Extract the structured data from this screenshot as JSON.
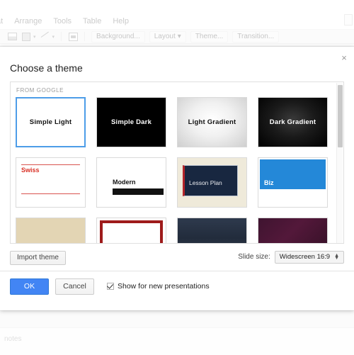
{
  "background_app": {
    "menubar": [
      {
        "label": "at"
      },
      {
        "label": "Arrange"
      },
      {
        "label": "Tools"
      },
      {
        "label": "Table"
      },
      {
        "label": "Help"
      }
    ],
    "toolbar": {
      "background_button": "Background...",
      "layout_button": "Layout",
      "theme_button": "Theme...",
      "transition_button": "Transition...",
      "caret": "▾"
    },
    "notes_label": "notes"
  },
  "dialog": {
    "title": "Choose a theme",
    "close_icon": "×",
    "group_label": "FROM GOOGLE",
    "themes": [
      {
        "name": "Simple Light",
        "style": "sw-simple-light",
        "selected": true
      },
      {
        "name": "Simple Dark",
        "style": "sw-simple-dark",
        "selected": false
      },
      {
        "name": "Light Gradient",
        "style": "sw-light-grad",
        "selected": false
      },
      {
        "name": "Dark Gradient",
        "style": "sw-dark-grad",
        "selected": false
      },
      {
        "name": "Swiss",
        "style": "sw-swiss",
        "selected": false
      },
      {
        "name": "Modern",
        "style": "sw-modern",
        "selected": false
      },
      {
        "name": "Lesson Plan",
        "style": "sw-lesson",
        "selected": false
      },
      {
        "name": "Biz",
        "style": "sw-biz",
        "selected": false
      },
      {
        "name": "",
        "style": "sw-plain-tan",
        "selected": false
      },
      {
        "name": "",
        "style": "sw-red-frame",
        "selected": false
      },
      {
        "name": "",
        "style": "sw-navy-tex",
        "selected": false
      },
      {
        "name": "",
        "style": "sw-plum",
        "selected": false
      }
    ],
    "import_button": "Import theme",
    "slide_size_label": "Slide size:",
    "slide_size_value": "Widescreen 16:9",
    "ok_button": "OK",
    "cancel_button": "Cancel",
    "show_for_new_label": "Show for new presentations",
    "show_for_new_checked": true
  },
  "colors": {
    "accent_blue": "#4285f4",
    "selection_blue": "#4d9de8",
    "biz_blue": "#2488d8",
    "swiss_red": "#d93025",
    "lesson_navy": "#182740",
    "lesson_cream": "#efeada"
  }
}
